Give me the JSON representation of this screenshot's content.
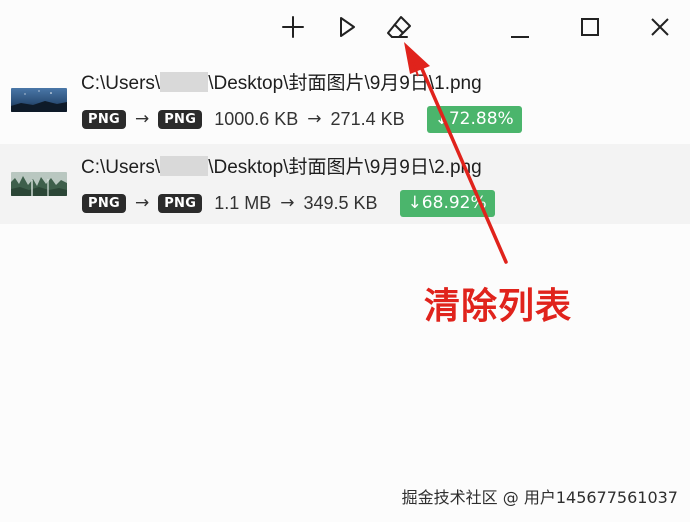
{
  "toolbar": {
    "icons": [
      "plus-icon",
      "play-icon",
      "eraser-icon"
    ],
    "window_icons": [
      "minimize-icon",
      "maximize-icon",
      "close-icon"
    ]
  },
  "files": [
    {
      "path_prefix": "C:\\Users\\",
      "path_suffix": "\\Desktop\\封面图片\\9月9日\\1.png",
      "from_format": "PNG",
      "to_format": "PNG",
      "size_before": "1000.6 KB",
      "size_after": "271.4 KB",
      "reduction": "↓72.88%",
      "thumbnail": "night-sky-thumbnail"
    },
    {
      "path_prefix": "C:\\Users\\",
      "path_suffix": "\\Desktop\\封面图片\\9月9日\\2.png",
      "from_format": "PNG",
      "to_format": "PNG",
      "size_before": "1.1 MB",
      "size_after": "349.5 KB",
      "reduction": "↓68.92%",
      "thumbnail": "forest-thumbnail"
    }
  ],
  "arrow_glyph": "→",
  "annotation": {
    "label": "清除列表",
    "color": "#e0231c"
  },
  "watermark": "掘金技术社区 @ 用户145677561037",
  "colors": {
    "badge_dark": "#2b2b2b",
    "reduction_green": "#4bb56c",
    "row_alt": "#f3f3f3"
  }
}
